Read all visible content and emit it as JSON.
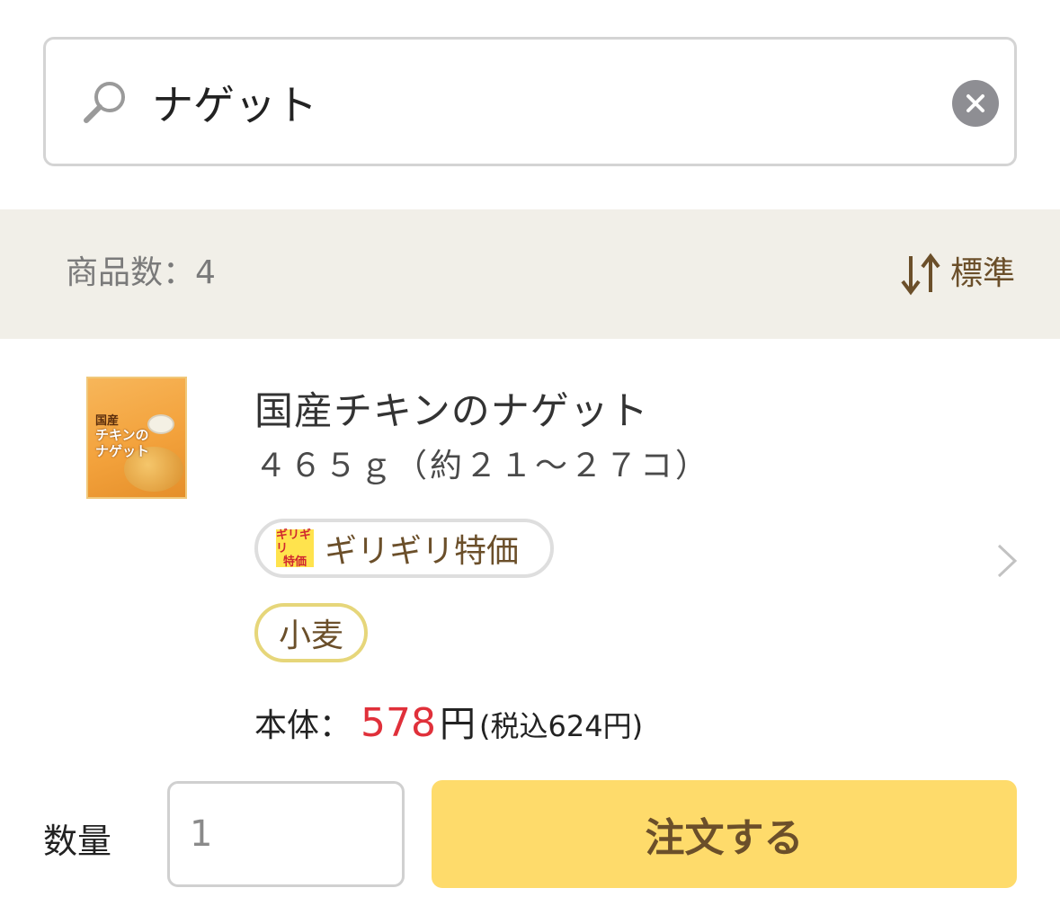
{
  "search": {
    "value": "ナゲット",
    "icon": "search-icon",
    "clear_icon": "clear-icon"
  },
  "results": {
    "count_text": "商品数：4",
    "sort_label": "標準",
    "sort_icon": "sort-icon"
  },
  "product": {
    "name": "国産チキンのナゲット",
    "size": "４６５ｇ（約２１～２７コ）",
    "thumbnail": {
      "line1": "国産",
      "line2": "チキンの",
      "line3": "ナゲット"
    },
    "sale_badge": {
      "mark_line1": "ギリギリ",
      "mark_line2": "特価",
      "label": "ギリギリ特価"
    },
    "allergen": "小麦",
    "price": {
      "label": "本体：",
      "value": "578",
      "currency": "円",
      "tax_included": "(税込624円)"
    }
  },
  "order": {
    "qty_label": "数量",
    "qty_value": "1",
    "button_label": "注文する"
  },
  "colors": {
    "accent_price": "#e0303a",
    "brand_brown": "#6b4f2a",
    "order_button": "#fedb6b",
    "band_background": "#f1efe8",
    "allergen_border": "#e6d67a"
  }
}
